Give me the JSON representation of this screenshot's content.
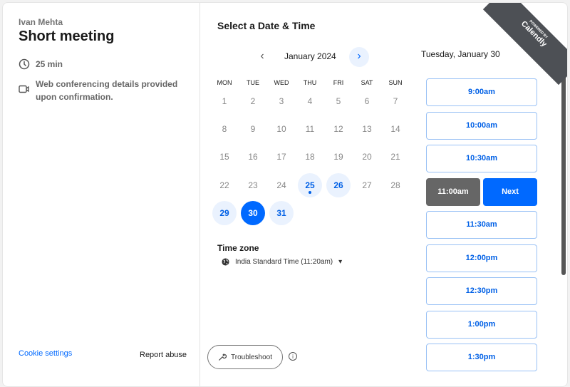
{
  "host": "Ivan Mehta",
  "event_title": "Short meeting",
  "duration": "25 min",
  "conferencing": "Web conferencing details provided upon confirmation.",
  "cookie_settings": "Cookie settings",
  "report_abuse": "Report abuse",
  "heading": "Select a Date & Time",
  "month": "January 2024",
  "weekdays": [
    "MON",
    "TUE",
    "WED",
    "THU",
    "FRI",
    "SAT",
    "SUN"
  ],
  "days": [
    [
      "1",
      "2",
      "3",
      "4",
      "5",
      "6",
      "7"
    ],
    [
      "8",
      "9",
      "10",
      "11",
      "12",
      "13",
      "14"
    ],
    [
      "15",
      "16",
      "17",
      "18",
      "19",
      "20",
      "21"
    ],
    [
      "22",
      "23",
      "24",
      "25",
      "26",
      "27",
      "28"
    ],
    [
      "29",
      "30",
      "31"
    ]
  ],
  "available_days": [
    "25",
    "26",
    "29",
    "30",
    "31"
  ],
  "selected_day": "30",
  "today": "25",
  "timezone_label": "Time zone",
  "timezone": "India Standard Time (11:20am)",
  "troubleshoot": "Troubleshoot",
  "info": "i",
  "selected_date": "Tuesday, January 30",
  "slots": [
    "9:00am",
    "10:00am",
    "10:30am",
    "11:00am",
    "11:30am",
    "12:00pm",
    "12:30pm",
    "1:00pm",
    "1:30pm"
  ],
  "selected_slot": "11:00am",
  "next_label": "Next",
  "badge": {
    "powered": "POWERED BY",
    "brand": "Calendly"
  },
  "colors": {
    "accent": "#0069ff",
    "available_bg": "#eaf2fe",
    "selected_slot": "#666666"
  }
}
